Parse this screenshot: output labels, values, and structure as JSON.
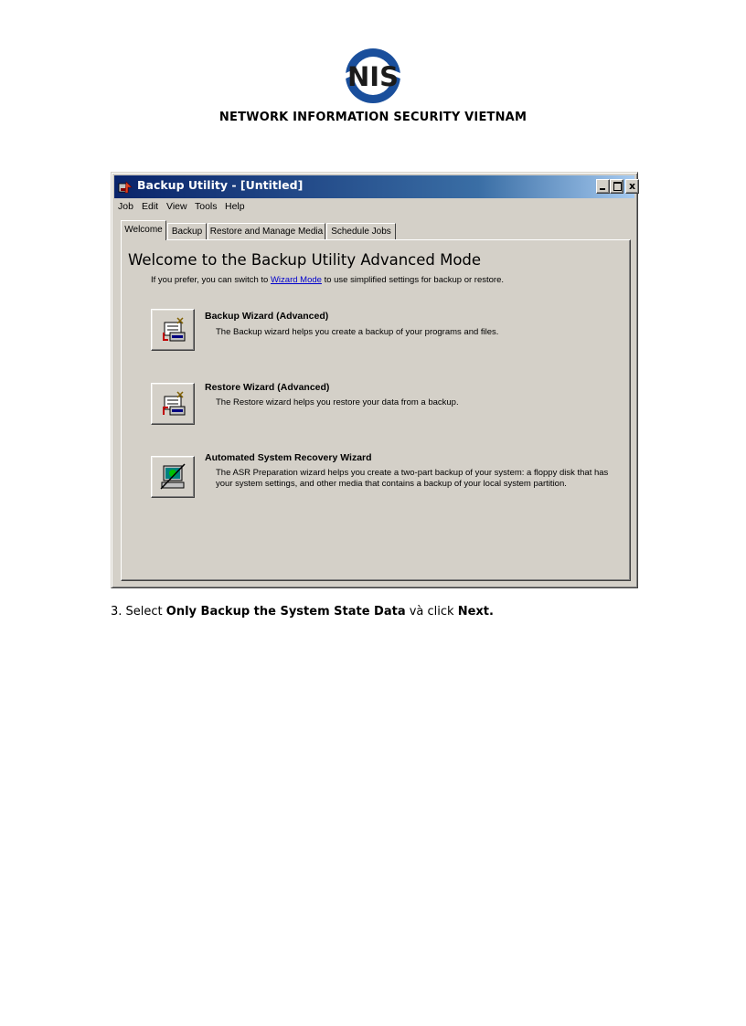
{
  "header": {
    "logo_text": "NIS",
    "org_name": "NETWORK INFORMATION SECURITY VIETNAM"
  },
  "window": {
    "title": "Backup Utility - [Untitled]",
    "controls": {
      "minimize": "_",
      "maximize": "□",
      "close": "x"
    },
    "menu": [
      "Job",
      "Edit",
      "View",
      "Tools",
      "Help"
    ],
    "tabs": [
      "Welcome",
      "Backup",
      "Restore and Manage Media",
      "Schedule Jobs"
    ],
    "active_tab": "Welcome",
    "heading": "Welcome to the Backup Utility Advanced Mode",
    "prefer_before": "If you prefer, you can switch to ",
    "prefer_link": "Wizard Mode",
    "prefer_after": " to use simplified settings for backup or restore.",
    "wizards": [
      {
        "title": "Backup Wizard (Advanced)",
        "description": "The Backup wizard helps you create a backup of your programs and files.",
        "icon": "backup-wizard-icon"
      },
      {
        "title": "Restore Wizard (Advanced)",
        "description": "The Restore wizard helps you restore your data from a backup.",
        "icon": "restore-wizard-icon"
      },
      {
        "title": "Automated System Recovery Wizard",
        "description": "The ASR Preparation wizard helps you create a two-part backup of your system: a floppy disk that has your system settings, and other media that contains a backup of your local system partition.",
        "icon": "asr-wizard-icon"
      }
    ]
  },
  "step": {
    "prefix": "3. Select ",
    "bold1": "Only Backup the System State Data",
    "middle": " và click ",
    "bold2": "Next."
  },
  "colors": {
    "titlebar_start": "#0a246a",
    "titlebar_end": "#a6caf0",
    "window_face": "#d4d0c8",
    "link": "#0000cc",
    "logo_blue": "#1a4f9c"
  }
}
